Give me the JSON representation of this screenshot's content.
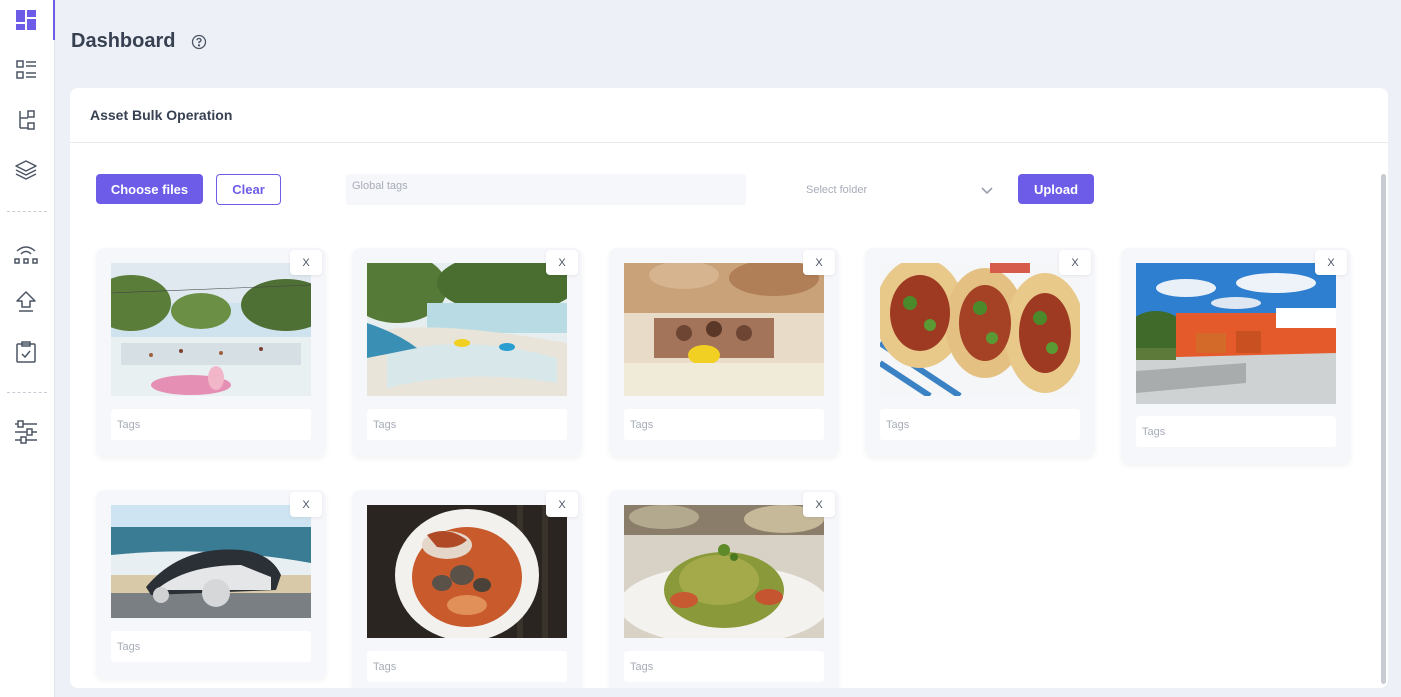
{
  "header": {
    "title": "Dashboard"
  },
  "card": {
    "title": "Asset Bulk Operation"
  },
  "toolbar": {
    "choose_files_label": "Choose files",
    "clear_label": "Clear",
    "global_tags_placeholder": "Global tags",
    "select_folder_placeholder": "Select folder",
    "upload_label": "Upload"
  },
  "sidebar": {
    "icons": [
      "dashboard-icon",
      "list-icon",
      "hierarchy-icon",
      "layers-icon",
      "network-icon",
      "upload-icon",
      "clipboard-check-icon",
      "sliders-icon"
    ]
  },
  "assets": [
    {
      "remove_label": "X",
      "tags_placeholder": "Tags",
      "image": "water-park-pool"
    },
    {
      "remove_label": "X",
      "tags_placeholder": "Tags",
      "image": "water-park-lazy-river"
    },
    {
      "remove_label": "X",
      "tags_placeholder": "Tags",
      "image": "water-slide-people"
    },
    {
      "remove_label": "X",
      "tags_placeholder": "Tags",
      "image": "tacos"
    },
    {
      "remove_label": "X",
      "tags_placeholder": "Tags",
      "image": "construction-equipment-yard"
    },
    {
      "remove_label": "X",
      "tags_placeholder": "Tags",
      "image": "solar-car-beach"
    },
    {
      "remove_label": "X",
      "tags_placeholder": "Tags",
      "image": "crab-seafood-dish"
    },
    {
      "remove_label": "X",
      "tags_placeholder": "Tags",
      "image": "pesto-pasta"
    }
  ],
  "colors": {
    "accent": "#6c5ce7",
    "background": "#eef0f8"
  }
}
